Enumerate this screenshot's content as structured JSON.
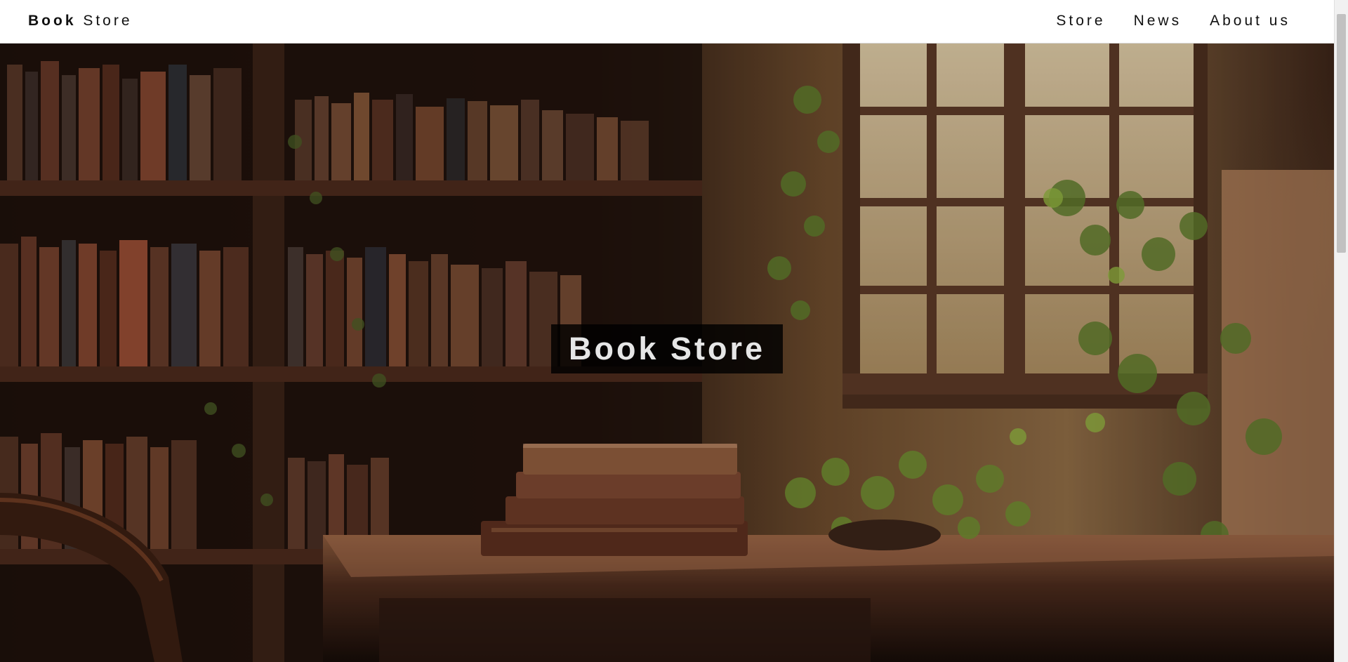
{
  "navbar": {
    "brand_bold": "Book",
    "brand_rest": "Store",
    "links": [
      {
        "label": "Store"
      },
      {
        "label": "News"
      },
      {
        "label": "About us"
      }
    ]
  },
  "hero": {
    "title": "Book Store",
    "image_alt": "Warm-lit library with bookshelves, stacked books on a wooden desk, ivy plants and a sunny window"
  },
  "colors": {
    "nav_background": "#ffffff",
    "nav_text": "#111111",
    "hero_title_box": "#000000",
    "hero_title_text": "#e6e6e6"
  },
  "icons": {
    "scrollbar": "vertical-scrollbar"
  }
}
